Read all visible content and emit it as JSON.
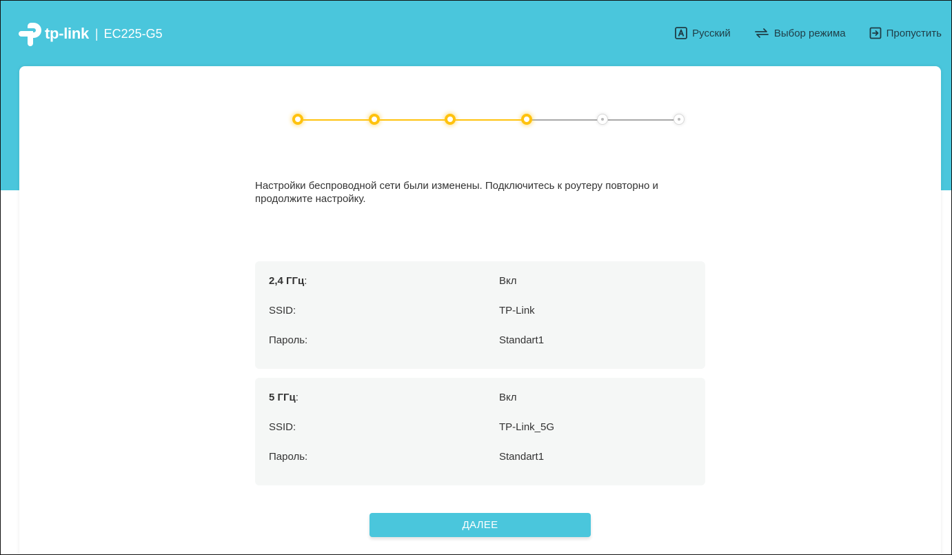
{
  "header": {
    "brand": "tp-link",
    "separator": "|",
    "model": "EC225-G5",
    "nav": {
      "language": "Русский",
      "mode": "Выбор режима",
      "skip": "Пропустить"
    },
    "colors": {
      "band": "#4ac6dc",
      "nav_text": "#1f3d46"
    }
  },
  "stepper": {
    "total_steps": 6,
    "completed_steps": 4,
    "colors": {
      "done": "#ffc20e",
      "todo": "#a9a9a9"
    }
  },
  "main": {
    "message": "Настройки беспроводной сети были изменены. Подключитесь к роутеру повторно и продолжите настройку.",
    "bands": [
      {
        "band_label": "2,4 ГГц",
        "band_suffix": ":",
        "status": "Вкл",
        "ssid_label": "SSID:",
        "ssid": "TP-Link",
        "password_label": "Пароль:",
        "password": "Standart1"
      },
      {
        "band_label": "5 ГГц",
        "band_suffix": ":",
        "status": "Вкл",
        "ssid_label": "SSID:",
        "ssid": "TP-Link_5G",
        "password_label": "Пароль:",
        "password": "Standart1"
      }
    ],
    "next_button": "ДАЛЕЕ"
  },
  "icons": {
    "logo": "tp-link-logo-icon",
    "language": "language-a-icon",
    "mode": "switch-arrows-icon",
    "skip": "exit-arrow-icon"
  }
}
